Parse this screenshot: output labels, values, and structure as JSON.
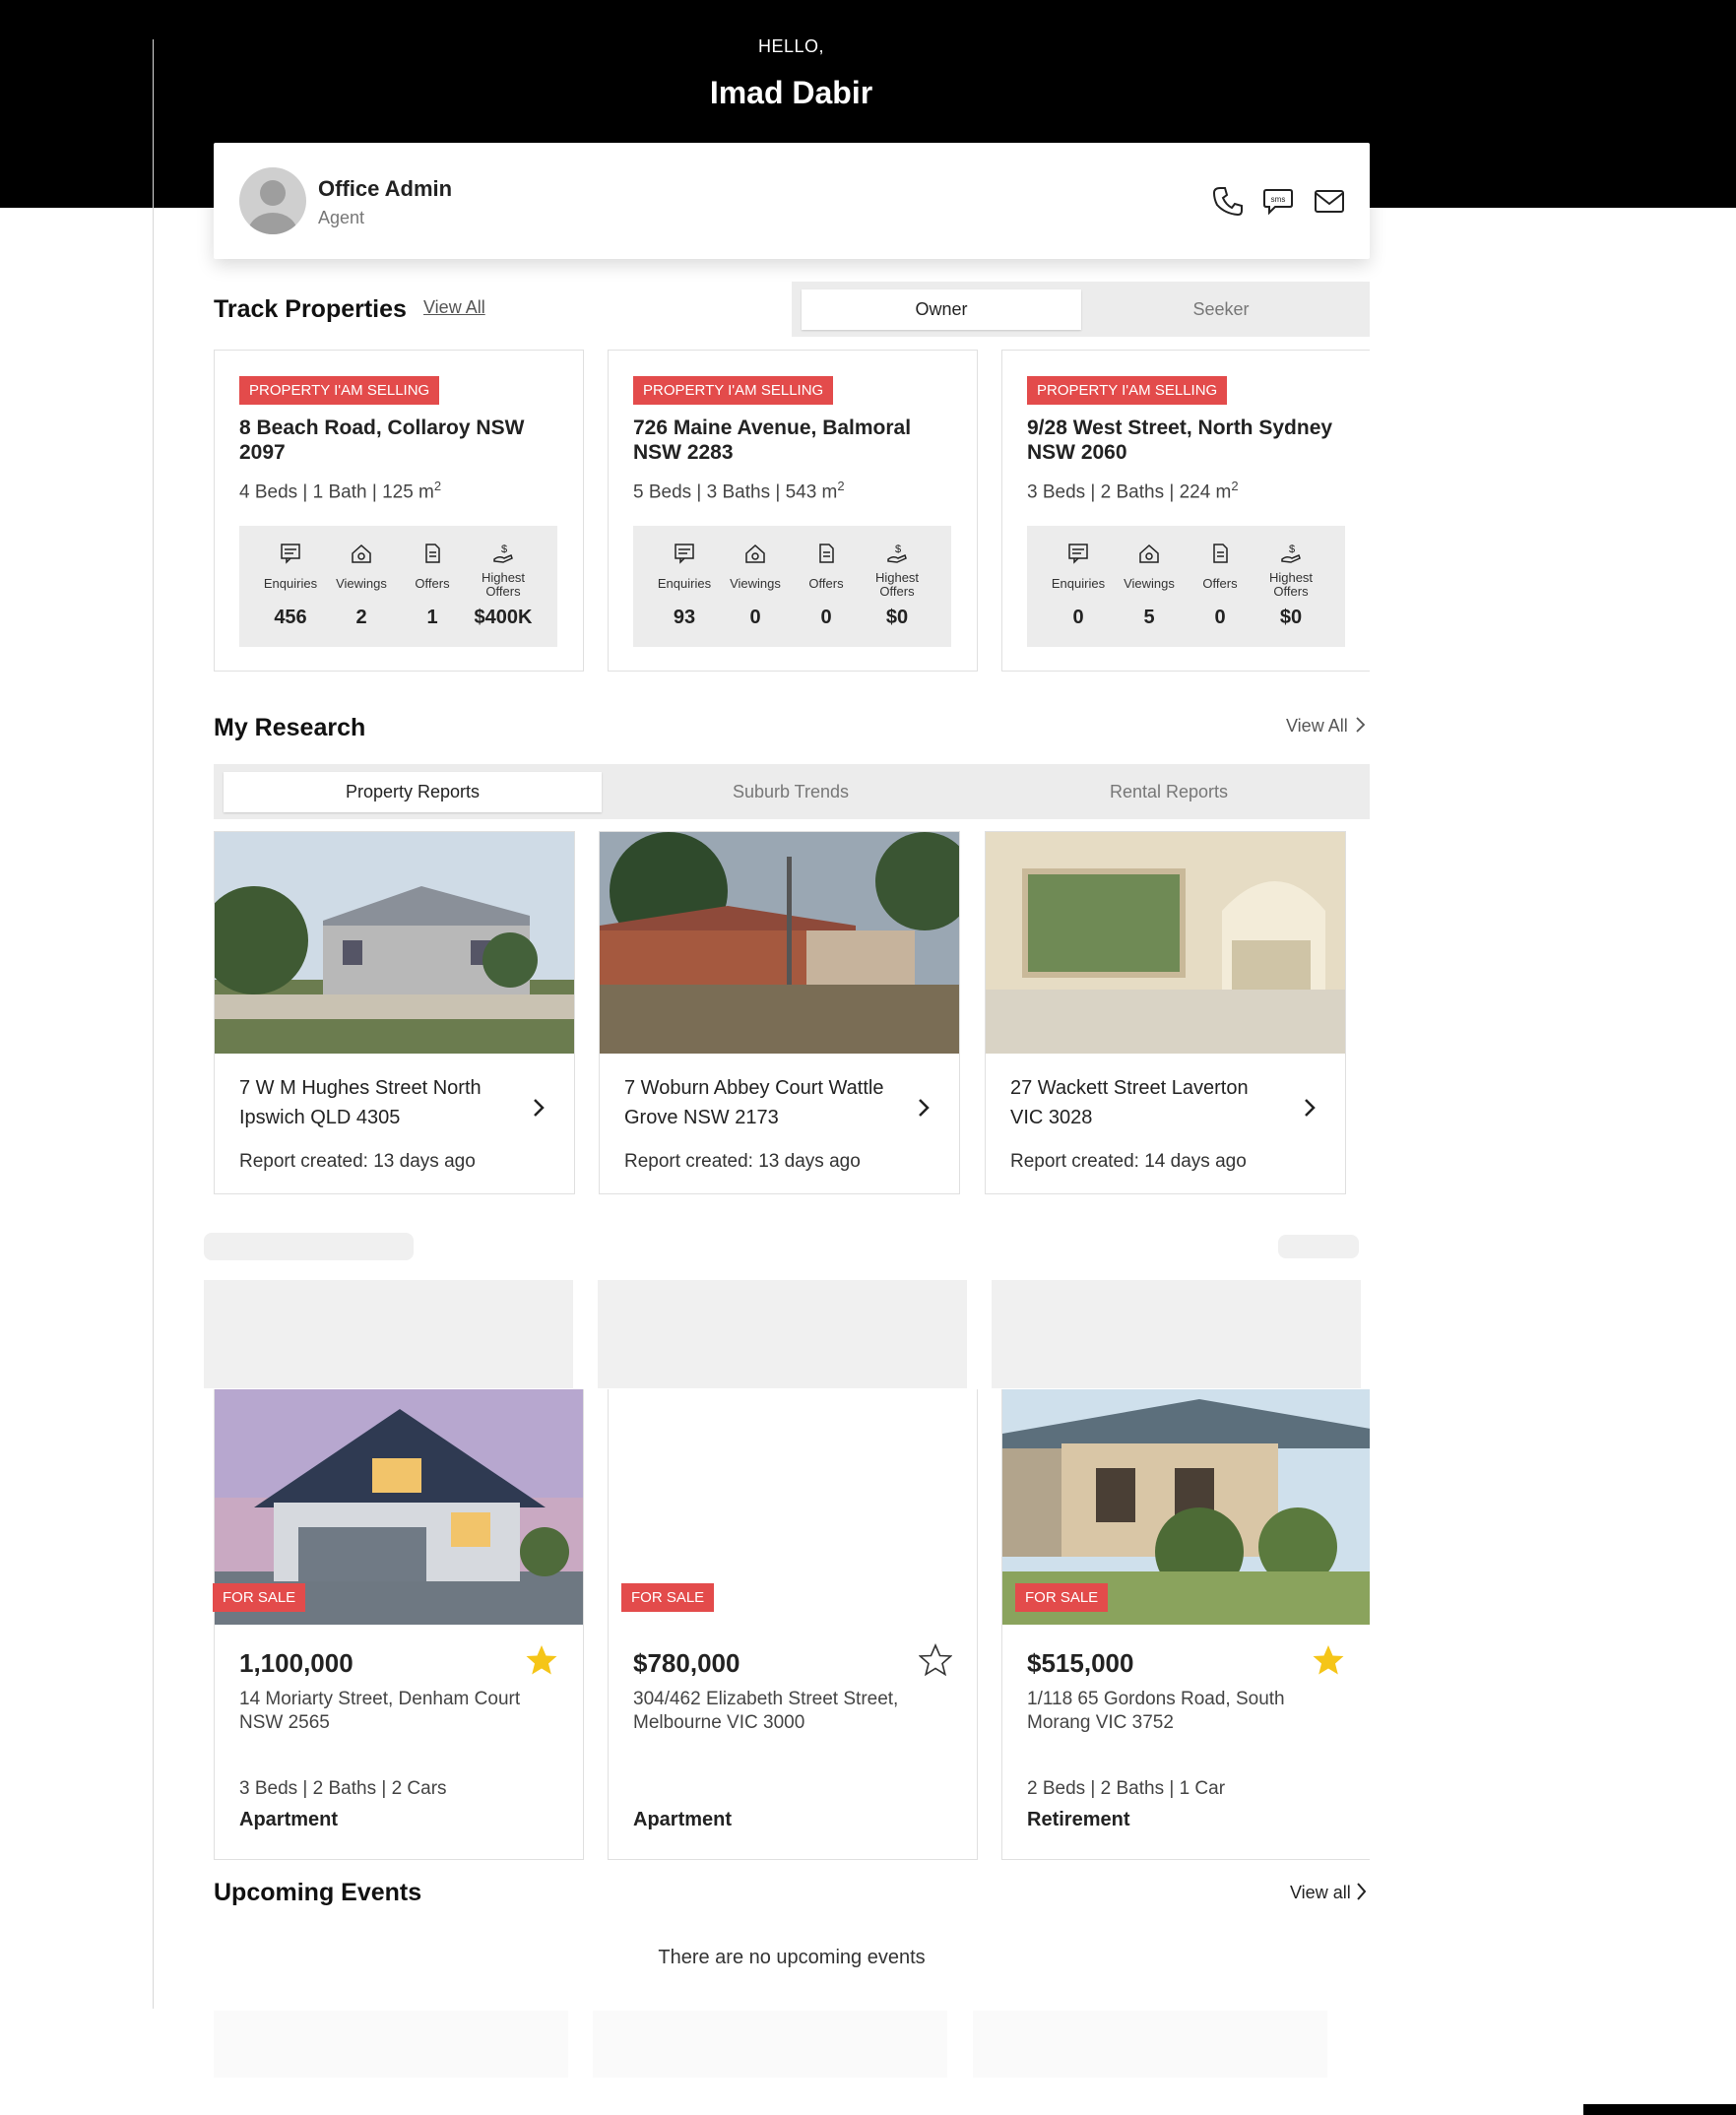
{
  "header": {
    "greeting": "HELLO,",
    "user_name": "Imad Dabir"
  },
  "agent": {
    "name": "Office Admin",
    "role": "Agent",
    "actions": [
      "phone-icon",
      "sms-icon",
      "mail-icon"
    ]
  },
  "track": {
    "title": "Track Properties",
    "view_all": "View All",
    "toggle": {
      "options": [
        "Owner",
        "Seeker"
      ],
      "selected": "Owner"
    },
    "stat_labels": [
      "Enquiries",
      "Viewings",
      "Offers",
      "Highest Offers"
    ],
    "cards": [
      {
        "tag": "PROPERTY I'AM SELLING",
        "address": "8 Beach Road, Collaroy NSW 2097",
        "details": "4 Beds | 1 Bath | 125 m",
        "sup": "2",
        "stats": [
          "456",
          "2",
          "1",
          "$400K"
        ]
      },
      {
        "tag": "PROPERTY I'AM SELLING",
        "address": "726 Maine Avenue, Balmoral NSW 2283",
        "details": "5 Beds | 3 Baths | 543 m",
        "sup": "2",
        "stats": [
          "93",
          "0",
          "0",
          "$0"
        ]
      },
      {
        "tag": "PROPERTY I'AM SELLING",
        "address": "9/28 West Street, North Sydney NSW 2060",
        "details": "3 Beds | 2 Baths | 224 m",
        "sup": "2",
        "stats": [
          "0",
          "5",
          "0",
          "$0"
        ]
      }
    ]
  },
  "research": {
    "title": "My Research",
    "view_all": "View All",
    "tabs": [
      "Property Reports",
      "Suburb Trends",
      "Rental Reports"
    ],
    "selected_tab": "Property Reports",
    "reports": [
      {
        "address": "7 W M Hughes Street North Ipswich QLD 4305",
        "created": "Report created: 13 days ago"
      },
      {
        "address": "7 Woburn Abbey Court Wattle Grove NSW 2173",
        "created": "Report created: 13 days ago"
      },
      {
        "address": "27 Wackett Street Laverton VIC 3028",
        "created": "Report created: 14 days ago"
      }
    ]
  },
  "listings": [
    {
      "tag": "FOR SALE",
      "price": "1,100,000",
      "address": "14 Moriarty Street, Denham Court NSW 2565",
      "details": "3 Beds | 2 Baths | 2 Cars",
      "type": "Apartment",
      "favorite": true
    },
    {
      "tag": "FOR SALE",
      "price": "$780,000",
      "address": "304/462 Elizabeth Street Street, Melbourne VIC 3000",
      "details": "",
      "type": "Apartment",
      "favorite": false
    },
    {
      "tag": "FOR SALE",
      "price": "$515,000",
      "address": "1/118 65 Gordons Road, South Morang VIC 3752",
      "details": "2 Beds | 2 Baths | 1 Car",
      "type": "Retirement",
      "favorite": true
    }
  ],
  "events": {
    "title": "Upcoming Events",
    "view_all": "View all",
    "empty_text": "There are no upcoming events"
  },
  "colors": {
    "accent": "#e34b4b",
    "star": "#f5c518",
    "header_bg": "#000000",
    "panel_bg": "#ececec"
  }
}
